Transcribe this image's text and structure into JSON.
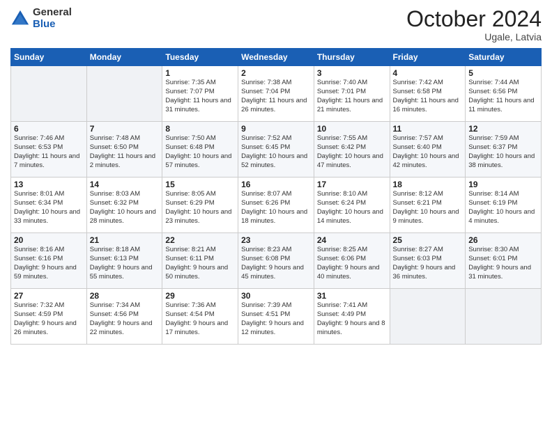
{
  "logo": {
    "general": "General",
    "blue": "Blue"
  },
  "header": {
    "month": "October 2024",
    "location": "Ugale, Latvia"
  },
  "weekdays": [
    "Sunday",
    "Monday",
    "Tuesday",
    "Wednesday",
    "Thursday",
    "Friday",
    "Saturday"
  ],
  "weeks": [
    [
      {
        "day": "",
        "info": ""
      },
      {
        "day": "",
        "info": ""
      },
      {
        "day": "1",
        "info": "Sunrise: 7:35 AM\nSunset: 7:07 PM\nDaylight: 11 hours and 31 minutes."
      },
      {
        "day": "2",
        "info": "Sunrise: 7:38 AM\nSunset: 7:04 PM\nDaylight: 11 hours and 26 minutes."
      },
      {
        "day": "3",
        "info": "Sunrise: 7:40 AM\nSunset: 7:01 PM\nDaylight: 11 hours and 21 minutes."
      },
      {
        "day": "4",
        "info": "Sunrise: 7:42 AM\nSunset: 6:58 PM\nDaylight: 11 hours and 16 minutes."
      },
      {
        "day": "5",
        "info": "Sunrise: 7:44 AM\nSunset: 6:56 PM\nDaylight: 11 hours and 11 minutes."
      }
    ],
    [
      {
        "day": "6",
        "info": "Sunrise: 7:46 AM\nSunset: 6:53 PM\nDaylight: 11 hours and 7 minutes."
      },
      {
        "day": "7",
        "info": "Sunrise: 7:48 AM\nSunset: 6:50 PM\nDaylight: 11 hours and 2 minutes."
      },
      {
        "day": "8",
        "info": "Sunrise: 7:50 AM\nSunset: 6:48 PM\nDaylight: 10 hours and 57 minutes."
      },
      {
        "day": "9",
        "info": "Sunrise: 7:52 AM\nSunset: 6:45 PM\nDaylight: 10 hours and 52 minutes."
      },
      {
        "day": "10",
        "info": "Sunrise: 7:55 AM\nSunset: 6:42 PM\nDaylight: 10 hours and 47 minutes."
      },
      {
        "day": "11",
        "info": "Sunrise: 7:57 AM\nSunset: 6:40 PM\nDaylight: 10 hours and 42 minutes."
      },
      {
        "day": "12",
        "info": "Sunrise: 7:59 AM\nSunset: 6:37 PM\nDaylight: 10 hours and 38 minutes."
      }
    ],
    [
      {
        "day": "13",
        "info": "Sunrise: 8:01 AM\nSunset: 6:34 PM\nDaylight: 10 hours and 33 minutes."
      },
      {
        "day": "14",
        "info": "Sunrise: 8:03 AM\nSunset: 6:32 PM\nDaylight: 10 hours and 28 minutes."
      },
      {
        "day": "15",
        "info": "Sunrise: 8:05 AM\nSunset: 6:29 PM\nDaylight: 10 hours and 23 minutes."
      },
      {
        "day": "16",
        "info": "Sunrise: 8:07 AM\nSunset: 6:26 PM\nDaylight: 10 hours and 18 minutes."
      },
      {
        "day": "17",
        "info": "Sunrise: 8:10 AM\nSunset: 6:24 PM\nDaylight: 10 hours and 14 minutes."
      },
      {
        "day": "18",
        "info": "Sunrise: 8:12 AM\nSunset: 6:21 PM\nDaylight: 10 hours and 9 minutes."
      },
      {
        "day": "19",
        "info": "Sunrise: 8:14 AM\nSunset: 6:19 PM\nDaylight: 10 hours and 4 minutes."
      }
    ],
    [
      {
        "day": "20",
        "info": "Sunrise: 8:16 AM\nSunset: 6:16 PM\nDaylight: 9 hours and 59 minutes."
      },
      {
        "day": "21",
        "info": "Sunrise: 8:18 AM\nSunset: 6:13 PM\nDaylight: 9 hours and 55 minutes."
      },
      {
        "day": "22",
        "info": "Sunrise: 8:21 AM\nSunset: 6:11 PM\nDaylight: 9 hours and 50 minutes."
      },
      {
        "day": "23",
        "info": "Sunrise: 8:23 AM\nSunset: 6:08 PM\nDaylight: 9 hours and 45 minutes."
      },
      {
        "day": "24",
        "info": "Sunrise: 8:25 AM\nSunset: 6:06 PM\nDaylight: 9 hours and 40 minutes."
      },
      {
        "day": "25",
        "info": "Sunrise: 8:27 AM\nSunset: 6:03 PM\nDaylight: 9 hours and 36 minutes."
      },
      {
        "day": "26",
        "info": "Sunrise: 8:30 AM\nSunset: 6:01 PM\nDaylight: 9 hours and 31 minutes."
      }
    ],
    [
      {
        "day": "27",
        "info": "Sunrise: 7:32 AM\nSunset: 4:59 PM\nDaylight: 9 hours and 26 minutes."
      },
      {
        "day": "28",
        "info": "Sunrise: 7:34 AM\nSunset: 4:56 PM\nDaylight: 9 hours and 22 minutes."
      },
      {
        "day": "29",
        "info": "Sunrise: 7:36 AM\nSunset: 4:54 PM\nDaylight: 9 hours and 17 minutes."
      },
      {
        "day": "30",
        "info": "Sunrise: 7:39 AM\nSunset: 4:51 PM\nDaylight: 9 hours and 12 minutes."
      },
      {
        "day": "31",
        "info": "Sunrise: 7:41 AM\nSunset: 4:49 PM\nDaylight: 9 hours and 8 minutes."
      },
      {
        "day": "",
        "info": ""
      },
      {
        "day": "",
        "info": ""
      }
    ]
  ]
}
